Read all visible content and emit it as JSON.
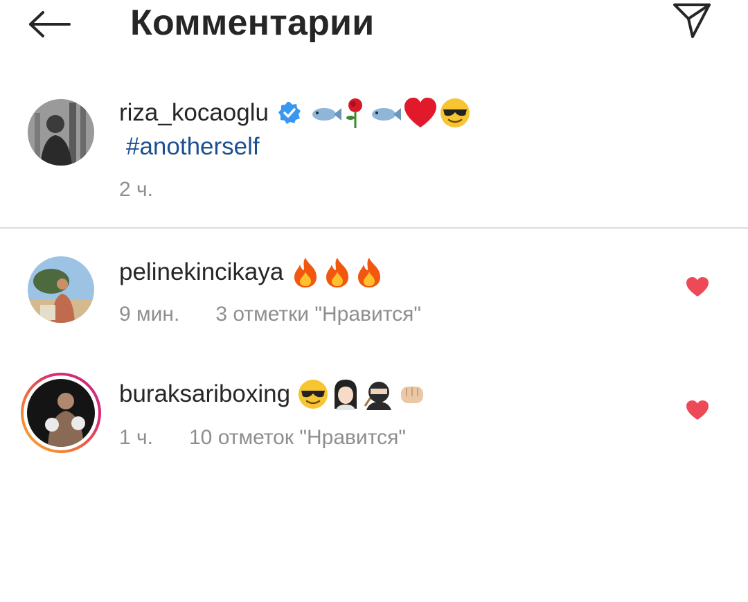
{
  "header": {
    "title": "Комментарии",
    "back_icon": "arrow-left-icon",
    "share_icon": "paper-plane-icon"
  },
  "caption": {
    "username": "riza_kocaoglu",
    "verified": true,
    "emojis": [
      "fish",
      "rose",
      "fish",
      "red-heart",
      "sunglasses-face"
    ],
    "hashtag": "#anotherself",
    "time": "2 ч."
  },
  "comments": [
    {
      "username": "pelinekincikaya",
      "emojis": [
        "fire",
        "fire",
        "fire"
      ],
      "time": "9 мин.",
      "likes": "3 отметки \"Нравится\"",
      "liked": true
    },
    {
      "username": "buraksariboxing",
      "has_story_ring": true,
      "emojis": [
        "sunglasses-face",
        "woman",
        "ninja",
        "oncoming-fist"
      ],
      "time": "1 ч.",
      "likes": "10 отметок \"Нравится\"",
      "liked": true
    }
  ],
  "colors": {
    "text": "#262626",
    "secondary": "#8e8e8e",
    "hashtag": "#1c4f8f",
    "verified": "#3897f0",
    "like_red": "#ed4956",
    "divider": "#dbdbdb"
  }
}
